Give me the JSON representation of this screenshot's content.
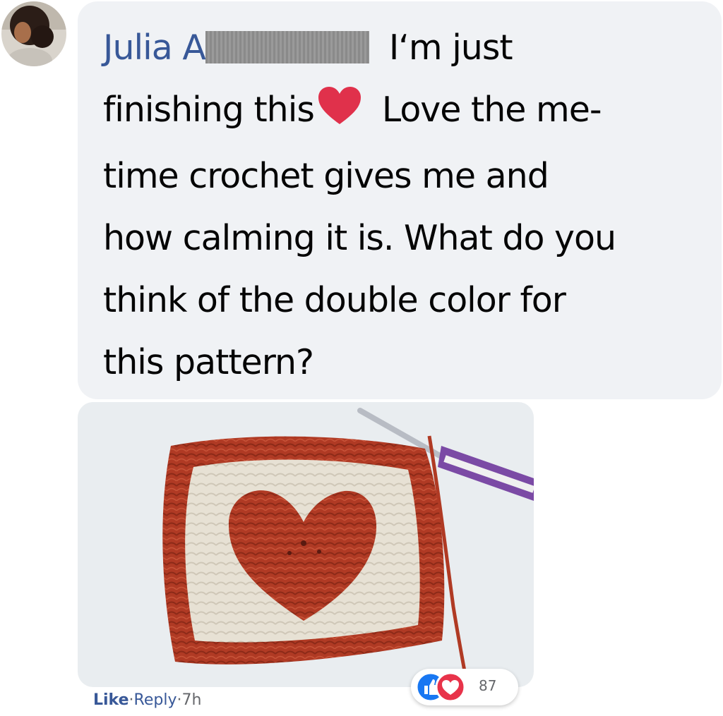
{
  "comment": {
    "author_visible": "Julia A",
    "text_line1_tail": "I‘m just",
    "text_line2_a": "finishing this",
    "text_line2_b": "Love the me-",
    "text_line3": "time crochet gives me and",
    "text_line4": "how calming it is. What do you",
    "text_line5": "think of the double color for",
    "text_line6": "this pattern?"
  },
  "actions": {
    "like_label": "Like",
    "reply_label": "Reply",
    "separator": "·",
    "time": "7h"
  },
  "reactions": {
    "count": "87",
    "icons": [
      "like-icon",
      "love-icon"
    ]
  },
  "colors": {
    "author": "#385898",
    "bubble": "#f0f2f5",
    "like_blue": "#1877f2",
    "love_red": "#e8334a",
    "yarn_red": "#b03a24",
    "yarn_cream": "#e7e1d4"
  }
}
